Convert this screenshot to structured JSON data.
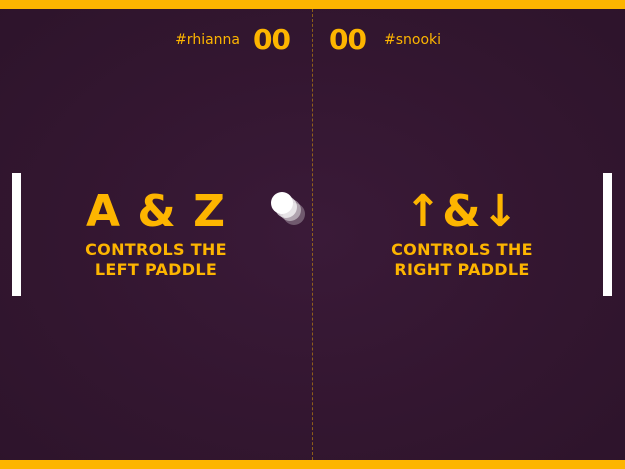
{
  "players": {
    "left": {
      "name": "#rhianna",
      "score": "00"
    },
    "right": {
      "name": "#snooki",
      "score": "00"
    }
  },
  "instructions": {
    "left": {
      "keys": "A & Z",
      "line1": "CONTROLS THE",
      "line2": "LEFT PADDLE"
    },
    "right": {
      "keys": "↑&↓",
      "line1": "CONTROLS THE",
      "line2": "RIGHT PADDLE"
    }
  },
  "colors": {
    "accent": "#fdb500",
    "background": "#331630",
    "paddle": "#ffffff",
    "ball": "#ffffff"
  }
}
